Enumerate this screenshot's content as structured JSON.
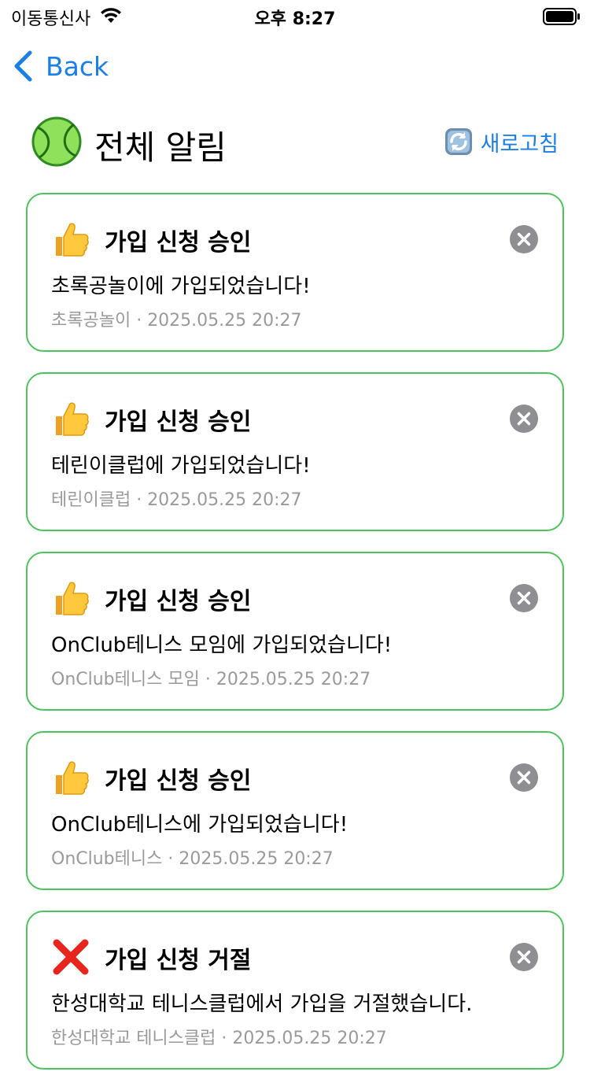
{
  "status_bar": {
    "carrier": "이동통신사",
    "time": "오후 8:27"
  },
  "nav": {
    "back_label": "Back"
  },
  "header": {
    "title": "전체 알림",
    "refresh_label": "새로고침"
  },
  "notifications": [
    {
      "type": "approved",
      "icon": "thumbs-up-icon",
      "title": "가입 신청 승인",
      "message": "초록공놀이에 가입되었습니다!",
      "club": "초록공놀이",
      "timestamp": "2025.05.25 20:27"
    },
    {
      "type": "approved",
      "icon": "thumbs-up-icon",
      "title": "가입 신청 승인",
      "message": "테린이클럽에 가입되었습니다!",
      "club": "테린이클럽",
      "timestamp": "2025.05.25 20:27"
    },
    {
      "type": "approved",
      "icon": "thumbs-up-icon",
      "title": "가입 신청 승인",
      "message": "OnClub테니스 모임에 가입되었습니다!",
      "club": "OnClub테니스 모임",
      "timestamp": "2025.05.25 20:27"
    },
    {
      "type": "approved",
      "icon": "thumbs-up-icon",
      "title": "가입 신청 승인",
      "message": "OnClub테니스에 가입되었습니다!",
      "club": "OnClub테니스",
      "timestamp": "2025.05.25 20:27"
    },
    {
      "type": "rejected",
      "icon": "cross-mark-icon",
      "title": "가입 신청 거절",
      "message": "한성대학교 테니스클럽에서 가입을 거절했습니다.",
      "club": "한성대학교 테니스클럽",
      "timestamp": "2025.05.25 20:27"
    }
  ],
  "colors": {
    "accent": "#1a7fe8",
    "card_border": "#4cc45a",
    "meta_text": "#9a9a9a",
    "close_button": "#8e8e93"
  }
}
